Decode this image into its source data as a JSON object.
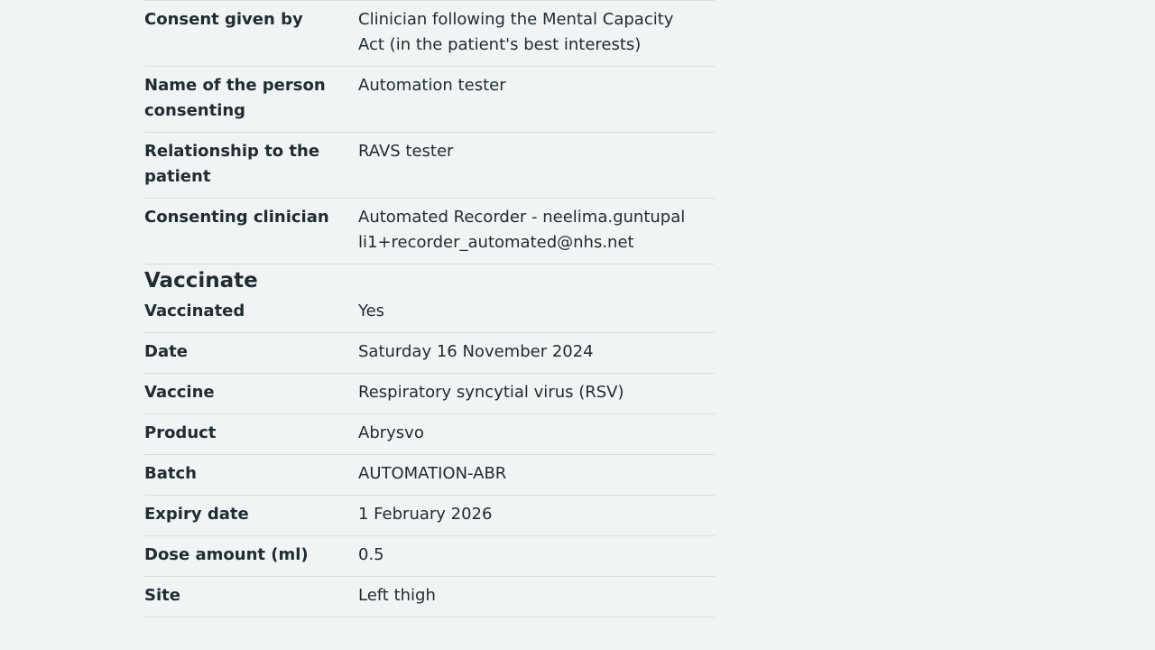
{
  "consent_rows": [
    {
      "key": "Consent given by",
      "value": "Clinician following the Mental Capacity Act (in the patient's best interests)"
    },
    {
      "key": "Name of the person consenting",
      "value": "Automation tester"
    },
    {
      "key": "Relationship to the patient",
      "value": "RAVS tester"
    },
    {
      "key": "Consenting clinician",
      "value": "Automated Recorder - neelima.guntupalli1+recorder_automated@nhs.net"
    }
  ],
  "vaccinate": {
    "heading": "Vaccinate",
    "rows": [
      {
        "key": "Vaccinated",
        "value": "Yes"
      },
      {
        "key": "Date",
        "value": "Saturday 16 November 2024"
      },
      {
        "key": "Vaccine",
        "value": "Respiratory syncytial virus (RSV)"
      },
      {
        "key": "Product",
        "value": "Abrysvo"
      },
      {
        "key": "Batch",
        "value": "AUTOMATION-ABR"
      },
      {
        "key": "Expiry date",
        "value": "1 February 2026"
      },
      {
        "key": "Dose amount (ml)",
        "value": "0.5"
      },
      {
        "key": "Site",
        "value": "Left thigh"
      }
    ]
  }
}
